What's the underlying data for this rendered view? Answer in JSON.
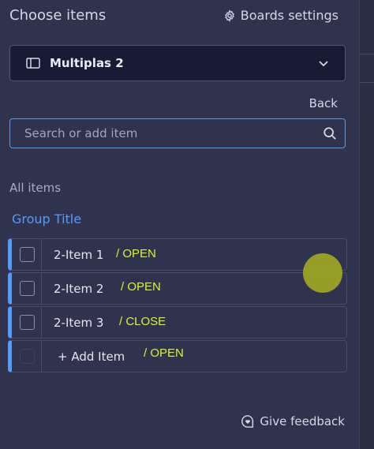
{
  "header": {
    "title": "Choose items",
    "boards_settings_label": "Boards settings"
  },
  "board_select": {
    "selected": "Multiplas 2"
  },
  "back_label": "Back",
  "search": {
    "placeholder": "Search or add item",
    "value": ""
  },
  "all_items_label": "All items",
  "group": {
    "title": "Group Title",
    "color": "#579bfc",
    "items": [
      {
        "name": "2-Item 1",
        "annotation": "/ OPEN"
      },
      {
        "name": "2-Item 2",
        "annotation": "/ OPEN"
      },
      {
        "name": "2-Item 3",
        "annotation": "/ CLOSE"
      }
    ],
    "add_item": {
      "label": "+ Add Item",
      "annotation": "/ OPEN"
    }
  },
  "feedback_label": "Give feedback",
  "colors": {
    "panel": "#30324e",
    "accent": "#579bfc",
    "annotation": "#d2f53c"
  },
  "icons": [
    "gear-icon",
    "board-icon",
    "chevron-down-icon",
    "search-icon",
    "feedback-icon"
  ]
}
